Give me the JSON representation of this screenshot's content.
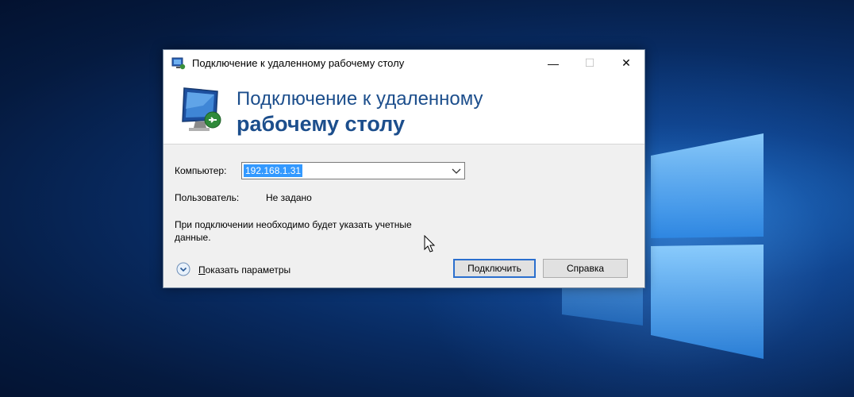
{
  "window": {
    "title": "Подключение к удаленному рабочему столу",
    "minimize_glyph": "—",
    "maximize_glyph": "☐",
    "close_glyph": "✕"
  },
  "banner": {
    "line1": "Подключение к удаленному",
    "line2": "рабочему столу",
    "icon": "remote-desktop-monitor-icon"
  },
  "form": {
    "computer_label": "Компьютер:",
    "computer_value": "192.168.1.31",
    "user_label": "Пользователь:",
    "user_value": "Не задано",
    "info_line1": "При подключении необходимо будет указать учетные",
    "info_line2": "данные."
  },
  "footer": {
    "show_params_prefix": "П",
    "show_params_rest": "оказать параметры",
    "connect_label": "Подключить",
    "help_label": "Справка"
  },
  "colors": {
    "banner_text": "#1c4e8c",
    "selection": "#3399ff",
    "primary_border": "#2b6fce"
  }
}
